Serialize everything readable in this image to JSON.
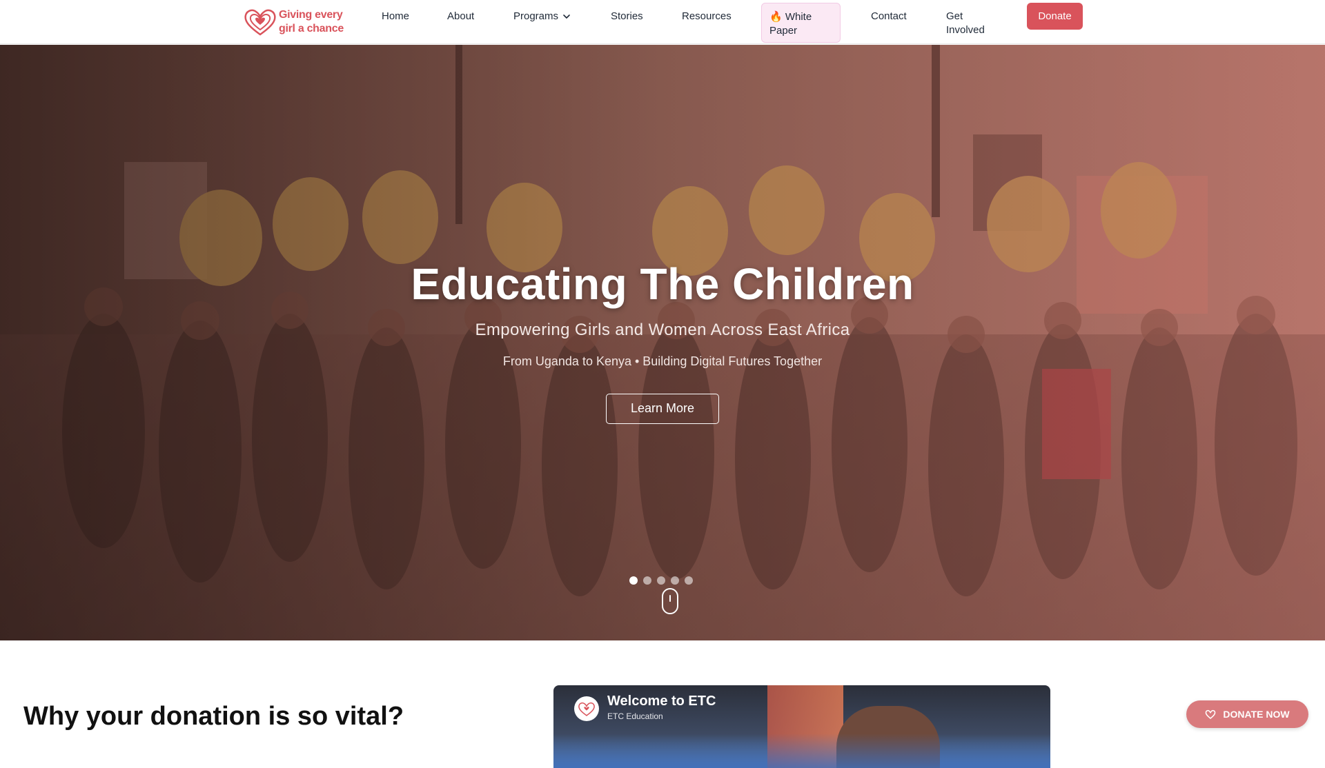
{
  "brand": {
    "name_line1": "Giving every",
    "name_line2": "girl a chance",
    "color": "#d9535b"
  },
  "nav": {
    "home": "Home",
    "about": "About",
    "programs": "Programs",
    "stories": "Stories",
    "resources": "Resources",
    "white_paper": "🔥 White Paper",
    "contact": "Contact",
    "get_involved": "Get Involved",
    "donate": "Donate"
  },
  "hero": {
    "title": "Educating The Children",
    "subtitle": "Empowering Girls and Women Across East Africa",
    "tagline": "From Uganda to Kenya • Building Digital Futures Together",
    "cta": "Learn More",
    "slides_total": 5,
    "active_slide": 1
  },
  "section": {
    "heading": "Why your donation is so vital?"
  },
  "video": {
    "title": "Welcome to ETC",
    "channel": "ETC Education"
  },
  "floating": {
    "donate_now": "DONATE NOW"
  },
  "colors": {
    "accent": "#d9535b",
    "highlight_bg": "#fbe9f4",
    "donate_float": "#d97a7d"
  }
}
